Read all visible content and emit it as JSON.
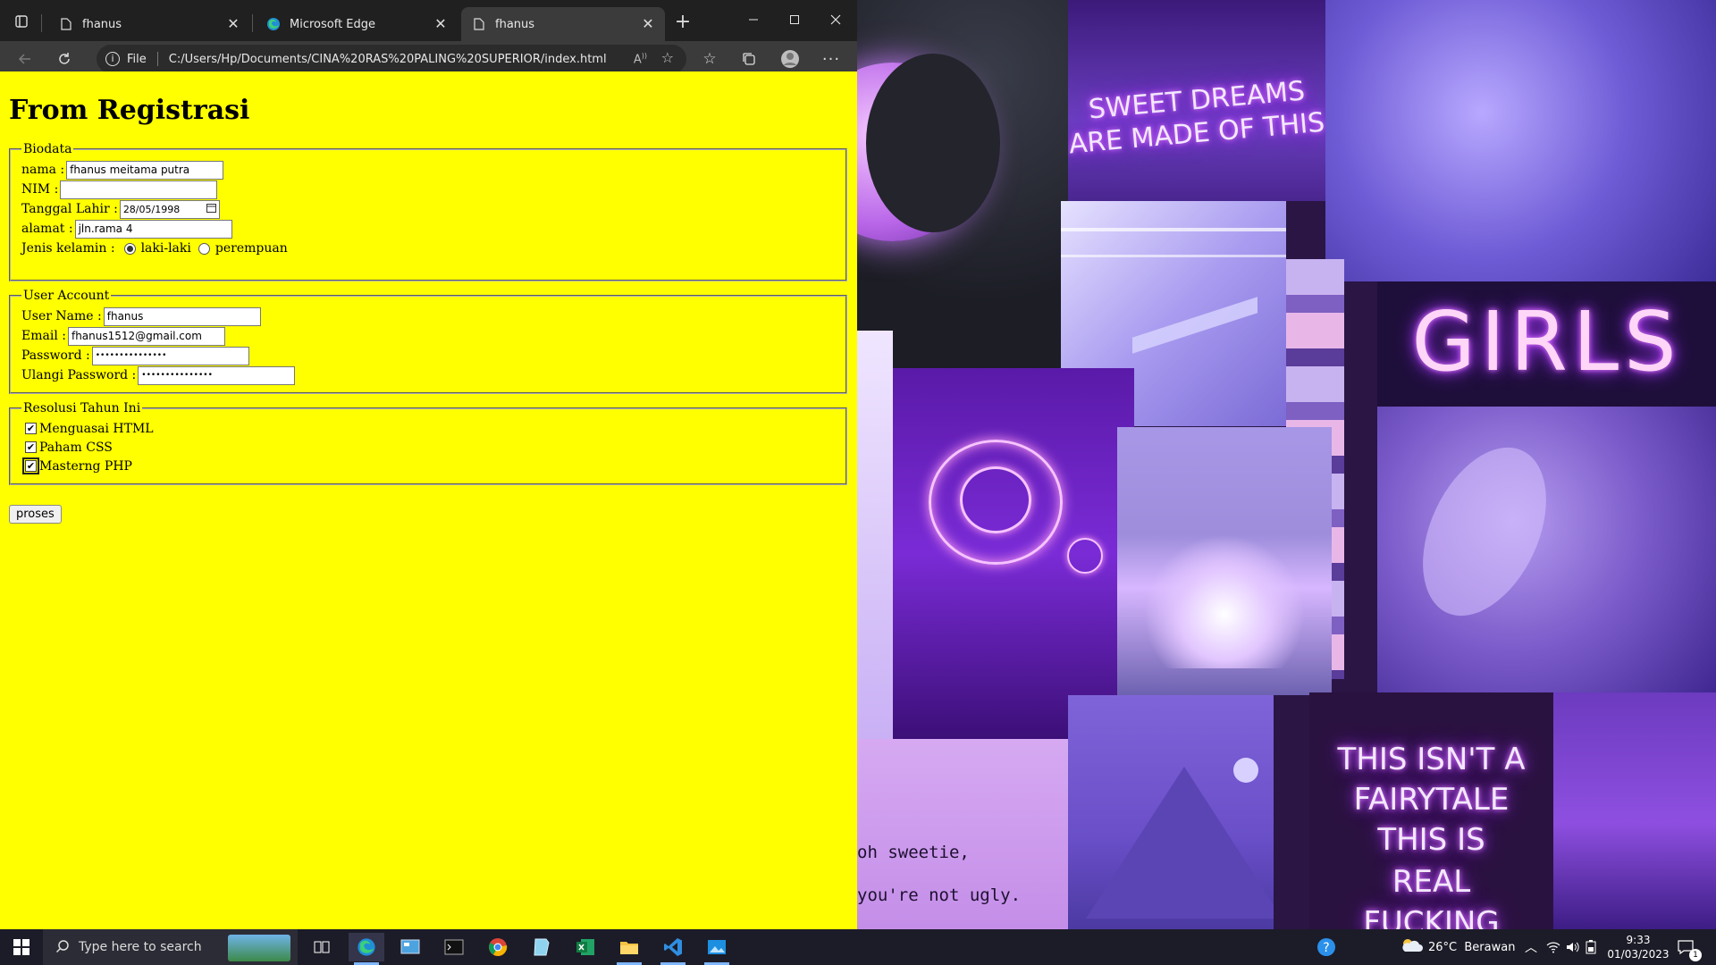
{
  "browser": {
    "tabs": [
      {
        "title": "fhanus",
        "active": false,
        "icon": "page-icon"
      },
      {
        "title": "Microsoft Edge",
        "active": false,
        "icon": "edge-icon"
      },
      {
        "title": "fhanus",
        "active": true,
        "icon": "page-icon"
      }
    ],
    "address": {
      "scheme_label": "File",
      "url": "C:/Users/Hp/Documents/CINA%20RAS%20PALING%20SUPERIOR/index.html"
    }
  },
  "page": {
    "heading": "From Registrasi",
    "biodata": {
      "legend": "Biodata",
      "nama_label": "nama :",
      "nama_value": "fhanus meitama putra",
      "nim_label": "NIM :",
      "nim_value": "",
      "tanggal_label": "Tanggal Lahir :",
      "tanggal_value": "28/05/1998",
      "alamat_label": "alamat :",
      "alamat_value": "jln.rama 4",
      "jenis_label": "Jenis kelamin :",
      "options": [
        "laki-laki",
        "perempuan"
      ],
      "selected": "laki-laki"
    },
    "account": {
      "legend": "User Account",
      "username_label": "User Name :",
      "username_value": "fhanus",
      "email_label": "Email :",
      "email_value": "fhanus1512@gmail.com",
      "password_label": "Password :",
      "password_value": "•••••••••••••••",
      "ulangi_label": "Ulangi Password :",
      "ulangi_value": "•••••••••••••••"
    },
    "resolusi": {
      "legend": "Resolusi Tahun Ini",
      "items": [
        {
          "label": "Menguasai HTML",
          "checked": true
        },
        {
          "label": "Paham CSS",
          "checked": true
        },
        {
          "label": "Masterng PHP",
          "checked": true
        }
      ]
    },
    "submit_label": "proses"
  },
  "wallpaper": {
    "texts": [
      "SWEET DREAMS",
      "ARE MADE OF THIS",
      "GIRLS",
      "THIS ISN'T A",
      "FAIRYTALE",
      "THIS IS",
      "REAL",
      "FUCKING",
      "oh sweetie,",
      "you're not ugly."
    ]
  },
  "taskbar": {
    "search_placeholder": "Type here to search",
    "weather": "26°C  Berawan",
    "time": "9:33",
    "date": "01/03/2023",
    "notification_count": "1"
  },
  "colors": {
    "page_bg": "#ffff00",
    "browser_chrome": "#3b3b3b",
    "taskbar": "#1c1c28",
    "accent": "#7fb6ff"
  }
}
